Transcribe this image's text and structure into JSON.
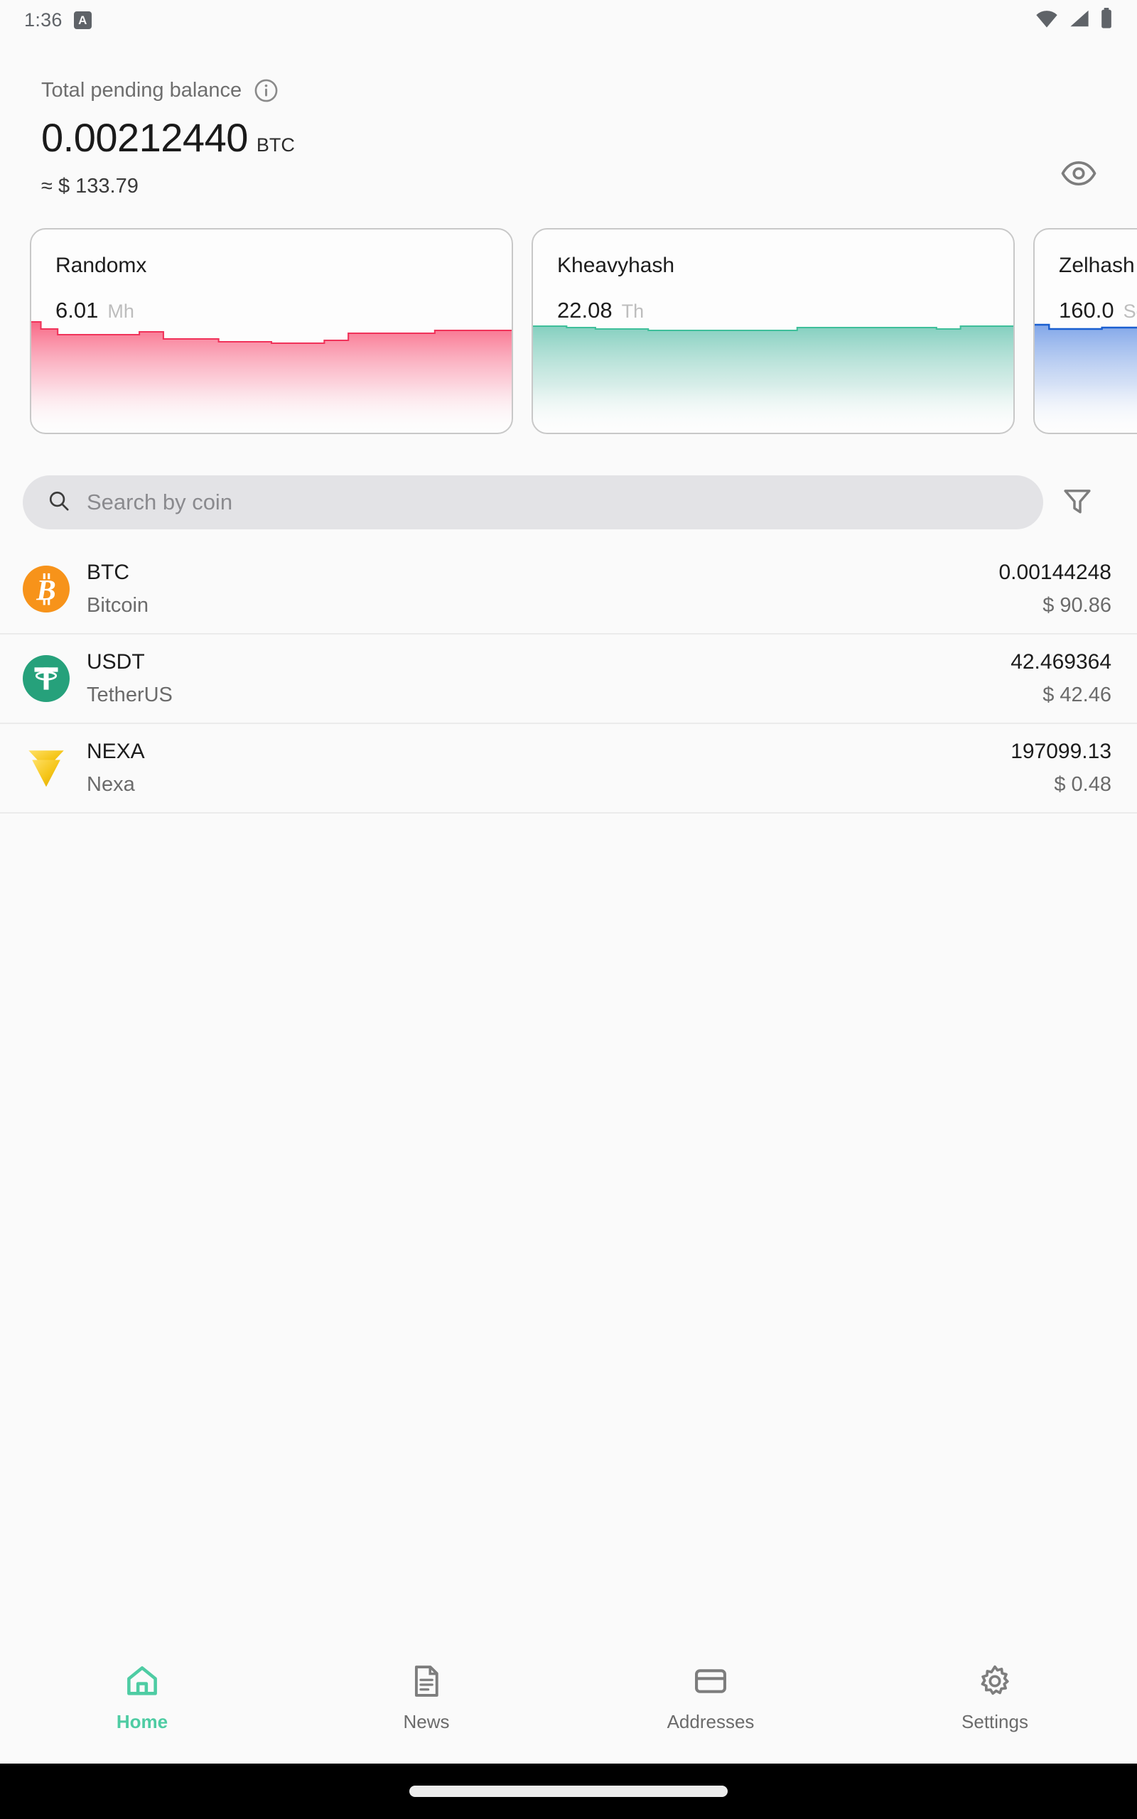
{
  "statusbar": {
    "time": "1:36",
    "app_badge": "A",
    "icons": [
      "wifi-icon",
      "cellular-signal-icon",
      "battery-icon"
    ]
  },
  "balance": {
    "label": "Total pending balance",
    "info_icon": "info-icon",
    "amount": "0.00212440",
    "unit": "BTC",
    "fiat": "≈ $ 133.79",
    "visibility_icon": "eye-icon"
  },
  "algo_cards": [
    {
      "title": "Randomx",
      "value": "6.01",
      "unit": "Mh",
      "line_color": "#f0335a",
      "fill_color": "#f86e8e"
    },
    {
      "title": "Kheavyhash",
      "value": "22.08",
      "unit": "Th",
      "line_color": "#3fbf9a",
      "fill_color": "#8fd6c6"
    },
    {
      "title": "Zelhash",
      "value": "160.0",
      "unit": "Sol",
      "line_color": "#1a5fd0",
      "fill_color": "#8fb2ec"
    }
  ],
  "search": {
    "placeholder": "Search by coin",
    "value": "",
    "search_icon": "search-icon",
    "filter_icon": "filter-icon"
  },
  "coins": [
    {
      "symbol": "BTC",
      "name": "Bitcoin",
      "amount": "0.00144248",
      "fiat": "$ 90.86",
      "logo": "bitcoin-logo",
      "logo_color": "#f7931a"
    },
    {
      "symbol": "USDT",
      "name": "TetherUS",
      "amount": "42.469364",
      "fiat": "$ 42.46",
      "logo": "tether-logo",
      "logo_color": "#26a17b"
    },
    {
      "symbol": "NEXA",
      "name": "Nexa",
      "amount": "197099.13",
      "fiat": "$ 0.48",
      "logo": "nexa-logo",
      "logo_color": "#f5c518"
    }
  ],
  "bottom_nav": {
    "active_color": "#4ecca3",
    "items": [
      {
        "label": "Home",
        "icon": "home-icon",
        "active": true
      },
      {
        "label": "News",
        "icon": "news-document-icon",
        "active": false
      },
      {
        "label": "Addresses",
        "icon": "card-icon",
        "active": false
      },
      {
        "label": "Settings",
        "icon": "gear-icon",
        "active": false
      }
    ]
  },
  "chart_data": [
    {
      "type": "area",
      "title": "Randomx",
      "ylabel": "Mh",
      "current_value": 6.01,
      "x": [
        0,
        1,
        2,
        3,
        4,
        5,
        6,
        7,
        8,
        9,
        10,
        11,
        12,
        13,
        14,
        15,
        16,
        17,
        18,
        19
      ],
      "values": [
        6.22,
        6.16,
        6.16,
        6.05,
        6.05,
        6.05,
        6.04,
        6.01,
        6.01,
        5.99,
        5.98,
        5.97,
        5.97,
        5.96,
        5.96,
        6.01,
        6.02,
        6.03,
        6.04,
        6.05
      ],
      "grid": false,
      "legend": "none"
    },
    {
      "type": "area",
      "title": "Kheavyhash",
      "ylabel": "Th",
      "current_value": 22.08,
      "x": [
        0,
        1,
        2,
        3,
        4,
        5,
        6,
        7,
        8,
        9,
        10,
        11,
        12,
        13,
        14,
        15,
        16,
        17,
        18,
        19
      ],
      "values": [
        22.12,
        22.11,
        22.1,
        22.09,
        22.08,
        22.08,
        22.07,
        22.07,
        22.06,
        22.08,
        22.09,
        22.09,
        22.09,
        22.09,
        22.09,
        22.08,
        22.07,
        22.09,
        22.09,
        22.1
      ],
      "grid": false,
      "legend": "none"
    },
    {
      "type": "area",
      "title": "Zelhash",
      "ylabel": "Sol",
      "current_value": 160.0,
      "x": [
        0,
        1,
        2,
        3,
        4,
        5,
        6,
        7,
        8,
        9,
        10,
        11,
        12,
        13,
        14,
        15,
        16,
        17,
        18,
        19
      ],
      "values": [
        161.0,
        160.5,
        160.4,
        160.3,
        160.2,
        160.1,
        160.0,
        160.0,
        160.0,
        160.0,
        160.0,
        160.0,
        159.9,
        159.9,
        160.0,
        160.0,
        160.0,
        160.0,
        160.0,
        160.0
      ],
      "grid": false,
      "legend": "none"
    }
  ]
}
